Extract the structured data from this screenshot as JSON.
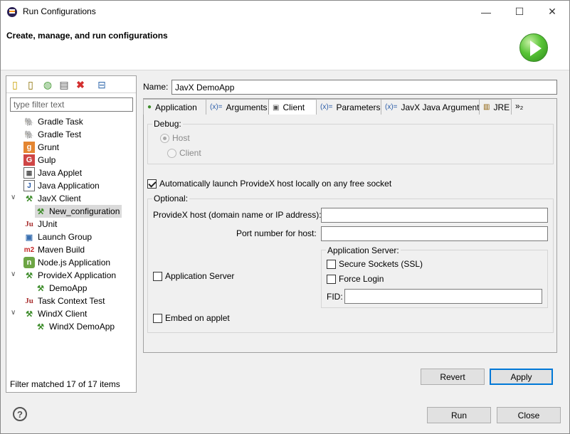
{
  "window": {
    "title": "Run Configurations",
    "minimize": "—",
    "maximize": "☐",
    "close": "✕"
  },
  "header": {
    "title": "Create, manage, and run configurations"
  },
  "sidebar": {
    "filter_placeholder": "type filter text",
    "items": [
      {
        "label": "Gradle Task",
        "icon": "gradle-icon"
      },
      {
        "label": "Gradle Test",
        "icon": "gradle-icon"
      },
      {
        "label": "Grunt",
        "icon": "grunt-icon"
      },
      {
        "label": "Gulp",
        "icon": "gulp-icon"
      },
      {
        "label": "Java Applet",
        "icon": "java-applet-icon"
      },
      {
        "label": "Java Application",
        "icon": "java-application-icon"
      },
      {
        "label": "JavX Client",
        "icon": "javx-icon",
        "expanded": true
      },
      {
        "label": "New_configuration",
        "icon": "javx-icon",
        "child": true,
        "selected": true
      },
      {
        "label": "JUnit",
        "icon": "junit-icon"
      },
      {
        "label": "Launch Group",
        "icon": "launch-group-icon"
      },
      {
        "label": "Maven Build",
        "icon": "maven-icon"
      },
      {
        "label": "Node.js Application",
        "icon": "nodejs-icon"
      },
      {
        "label": "ProvideX Application",
        "icon": "providex-icon",
        "expanded": true
      },
      {
        "label": "DemoApp",
        "icon": "providex-icon",
        "child": true
      },
      {
        "label": "Task Context Test",
        "icon": "junit-icon"
      },
      {
        "label": "WindX Client",
        "icon": "windx-icon",
        "expanded": true
      },
      {
        "label": "WindX DemoApp",
        "icon": "windx-icon",
        "child": true
      }
    ],
    "status": "Filter matched 17 of 17 items"
  },
  "config": {
    "name_label": "Name:",
    "name_value": "JavX DemoApp",
    "tabs": [
      {
        "label": "Application",
        "icon": "●"
      },
      {
        "label": "Arguments",
        "icon": "(x)="
      },
      {
        "label": "Client",
        "icon": "▣",
        "active": true
      },
      {
        "label": "Parameters",
        "icon": "(x)="
      },
      {
        "label": "JavX Java Arguments",
        "icon": "(x)="
      },
      {
        "label": "JRE",
        "icon": "▥"
      }
    ],
    "tab_overflow": "»₂",
    "debug": {
      "label": "Debug:",
      "host": "Host",
      "client": "Client"
    },
    "auto_launch": "Automatically launch ProvideX host locally on any free socket",
    "optional": {
      "label": "Optional:",
      "host_label": "ProvideX host (domain name or IP address):",
      "port_label": "Port number for host:",
      "app_server": "Application Server",
      "app_server_group": "Application Server:",
      "secure": "Secure Sockets (SSL)",
      "force_login": "Force Login",
      "fid": "FID:",
      "embed": "Embed on applet"
    },
    "revert": "Revert",
    "apply": "Apply"
  },
  "footer": {
    "help": "?",
    "run": "Run",
    "close": "Close"
  },
  "colors": {
    "accent": "#0078d7",
    "run_green": "#58c436"
  }
}
